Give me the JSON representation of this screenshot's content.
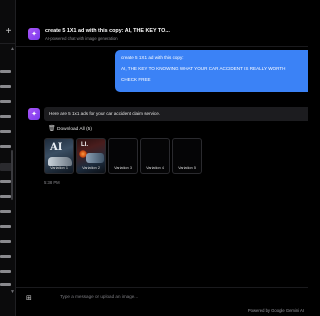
{
  "sidebar": {
    "new_chat_icon": "plus-icon",
    "items_count_visible": 16
  },
  "header": {
    "title": "create 5 1X1 ad with this copy: AI, THE KEY TO...",
    "subtitle": "AI-powered chat with image generation",
    "icon": "sparkle-icon"
  },
  "user_message": {
    "line1": "create 5 1X1 ad with this copy:",
    "line2": "AI, THE KEY TO KNOWING WHAT YOUR CAR ACCIDENT IS REALLY WORTH",
    "line3": "CHECK FREE"
  },
  "assistant_message": {
    "icon": "sparkle-icon",
    "text": "Here are 5 1x1 ads for your car accident claim service.",
    "download_all_label": "Download All (5)",
    "variations": [
      {
        "label": "Variation 1",
        "has_image": true,
        "image_text": "AI"
      },
      {
        "label": "Variation 2",
        "has_image": true,
        "image_text": "LI."
      },
      {
        "label": "Variation 3",
        "has_image": false
      },
      {
        "label": "Variation 4",
        "has_image": false
      },
      {
        "label": "Variation 5",
        "has_image": false
      }
    ],
    "timestamp": "5:38 PM"
  },
  "composer": {
    "placeholder": "Type a message or upload an image...",
    "attach_icon": "image-upload-icon"
  },
  "footer": {
    "text": "Powered by Google Gemini AI"
  },
  "colors": {
    "accent_blue": "#3b82f6",
    "brand_purple": "#8b5cf6",
    "background": "#000000"
  }
}
